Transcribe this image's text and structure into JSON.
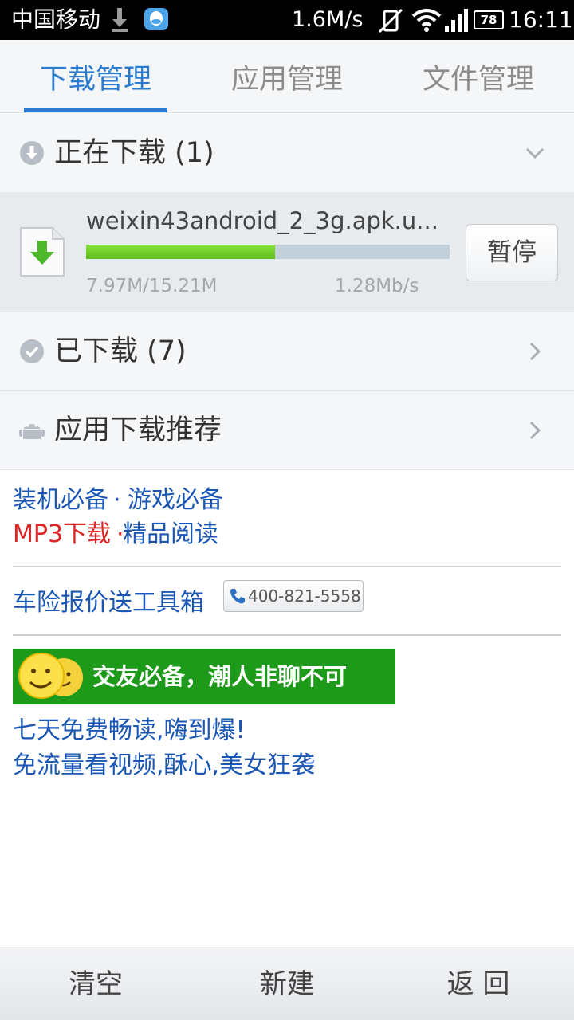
{
  "status_bar": {
    "carrier": "中国移动",
    "speed": "1.6M/s",
    "battery": "78",
    "time": "16:11"
  },
  "tabs": [
    {
      "label": "下载管理",
      "active": true
    },
    {
      "label": "应用管理",
      "active": false
    },
    {
      "label": "文件管理",
      "active": false
    }
  ],
  "downloading": {
    "label": "正在下载 (1)",
    "item": {
      "filename": "weixin43android_2_3g.apk.u...",
      "progress": 0.52,
      "size": "7.97M/15.21M",
      "speed": "1.28Mb/s",
      "pause_label": "暂停"
    }
  },
  "downloaded": {
    "label": "已下载 (7)"
  },
  "recommend": {
    "label": "应用下载推荐"
  },
  "links": {
    "essentials": "装机必备",
    "games": "游戏必备",
    "mp3": "MP3下载",
    "reading": "精品阅读",
    "separator": "·",
    "car_insurance": "车险报价送工具箱",
    "phone": "400-821-5558",
    "banner": "交友必备，潮人非聊不可",
    "free_read": "七天免费畅读,嗨到爆!",
    "free_video": "免流量看视频,酥心,美女狂袭"
  },
  "bottom_bar": {
    "clear": "清空",
    "new": "新建",
    "back": "返 回"
  },
  "colors": {
    "accent": "#2a7cd1",
    "link": "#1a56b3",
    "link_red": "#e02424",
    "progress": "#6ccc26",
    "banner": "#1e9a1a"
  }
}
